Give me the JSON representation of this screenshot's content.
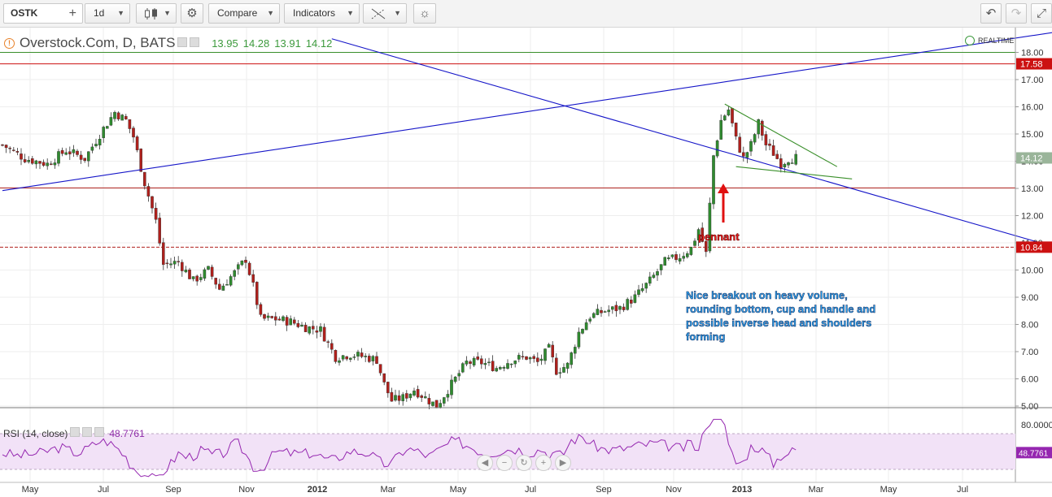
{
  "toolbar": {
    "symbol": "OSTK",
    "interval": "1d",
    "compare_label": "Compare",
    "indicators_label": "Indicators"
  },
  "legend": {
    "title": "Overstock.Com, D, BATS",
    "open": "13.95",
    "high": "14.28",
    "low": "13.91",
    "close": "14.12",
    "realtime": "REALTIME"
  },
  "rsi": {
    "label": "RSI (14, close)",
    "value": "48.7761"
  },
  "colors": {
    "up": "#2f8b2f",
    "down": "#b0201c",
    "trend_blue": "#1515c8",
    "pattern_green": "#3a8f2a",
    "level_red": "#cc1111",
    "rsi_line": "#9527b0",
    "rsi_band": "#f2e2f7",
    "annotation_text": "#2aa3f0"
  },
  "chart_data": {
    "type": "candlestick",
    "price_axis": {
      "ylim": [
        4.8,
        18.6
      ],
      "ticks": [
        "18.00",
        "17.00",
        "16.00",
        "15.00",
        "14.00",
        "13.00",
        "12.00",
        "11.00",
        "10.00",
        "9.00",
        "8.00",
        "7.00",
        "6.00",
        "5.00"
      ]
    },
    "time_axis": {
      "labels": [
        "May",
        "Jul",
        "Sep",
        "Nov",
        "2012",
        "Mar",
        "May",
        "Jul",
        "Sep",
        "Nov",
        "2013",
        "Mar",
        "May",
        "Jul"
      ]
    },
    "price_badges": [
      {
        "value": 17.58,
        "label": "17.58",
        "color": "#cc1111"
      },
      {
        "value": 14.12,
        "label": "14.12",
        "color": "#9ab59a"
      },
      {
        "value": 10.84,
        "label": "10.84",
        "color": "#cc1111"
      }
    ],
    "horizontal_levels": [
      {
        "value": 18.0,
        "color": "#3a8f2a",
        "style": "solid"
      },
      {
        "value": 17.58,
        "color": "#cc1111",
        "style": "solid"
      },
      {
        "value": 13.02,
        "color": "#b0201c",
        "style": "solid"
      },
      {
        "value": 10.84,
        "color": "#b0201c",
        "style": "dashed"
      }
    ],
    "anchors": [
      [
        0,
        14.6
      ],
      [
        6,
        14.1
      ],
      [
        12,
        13.9
      ],
      [
        17,
        14.4
      ],
      [
        22,
        14.1
      ],
      [
        27,
        15.2
      ],
      [
        30,
        15.8
      ],
      [
        33,
        15.5
      ],
      [
        35,
        14.9
      ],
      [
        38,
        13.2
      ],
      [
        41,
        11.8
      ],
      [
        43,
        10.2
      ],
      [
        47,
        10.3
      ],
      [
        51,
        9.6
      ],
      [
        55,
        10.0
      ],
      [
        58,
        9.3
      ],
      [
        62,
        9.9
      ],
      [
        65,
        10.4
      ],
      [
        67,
        9.4
      ],
      [
        69,
        8.2
      ],
      [
        73,
        8.2
      ],
      [
        77,
        8.1
      ],
      [
        81,
        7.9
      ],
      [
        85,
        7.8
      ],
      [
        89,
        6.8
      ],
      [
        93,
        6.9
      ],
      [
        97,
        6.8
      ],
      [
        100,
        6.7
      ],
      [
        102,
        5.8
      ],
      [
        104,
        5.2
      ],
      [
        107,
        5.3
      ],
      [
        110,
        5.6
      ],
      [
        113,
        5.3
      ],
      [
        116,
        5.0
      ],
      [
        120,
        5.8
      ],
      [
        124,
        6.6
      ],
      [
        128,
        6.6
      ],
      [
        132,
        6.4
      ],
      [
        136,
        6.7
      ],
      [
        140,
        6.8
      ],
      [
        143,
        6.6
      ],
      [
        146,
        7.1
      ],
      [
        148,
        6.3
      ],
      [
        151,
        6.5
      ],
      [
        154,
        7.7
      ],
      [
        157,
        8.3
      ],
      [
        161,
        8.5
      ],
      [
        165,
        8.6
      ],
      [
        169,
        9.0
      ],
      [
        173,
        9.6
      ],
      [
        177,
        10.3
      ],
      [
        181,
        10.5
      ],
      [
        184,
        10.8
      ],
      [
        186,
        11.5
      ],
      [
        188,
        10.6
      ],
      [
        190,
        14.2
      ],
      [
        192,
        15.5
      ],
      [
        194,
        15.9
      ],
      [
        196,
        14.8
      ],
      [
        198,
        14.1
      ],
      [
        200,
        14.6
      ],
      [
        202,
        15.4
      ],
      [
        204,
        14.6
      ],
      [
        206,
        14.3
      ],
      [
        208,
        13.9
      ],
      [
        210,
        14.1
      ],
      [
        212,
        14.12
      ]
    ],
    "drawings": [
      {
        "name": "trendline-rising",
        "color": "#1515c8",
        "from": [
          0,
          12.92
        ],
        "to": [
          284,
          18.8
        ]
      },
      {
        "name": "trendline-falling",
        "color": "#1515c8",
        "from": [
          88,
          18.5
        ],
        "to": [
          300,
          10.1
        ]
      },
      {
        "name": "pennant-upper",
        "color": "#3a8f2a",
        "from": [
          193,
          16.1
        ],
        "to": [
          223,
          13.8
        ]
      },
      {
        "name": "pennant-lower",
        "color": "#3a8f2a",
        "from": [
          196,
          13.8
        ],
        "to": [
          227,
          13.35
        ]
      }
    ],
    "annotations": {
      "pennant": "pennant",
      "note_lines": [
        "Nice breakout on heavy volume,",
        "rounding bottom, cup and handle and",
        "possible inverse head and shoulders",
        "forming"
      ]
    },
    "rsi_axis": {
      "ticks": [
        "80.0000"
      ],
      "band": [
        30,
        70
      ]
    }
  }
}
